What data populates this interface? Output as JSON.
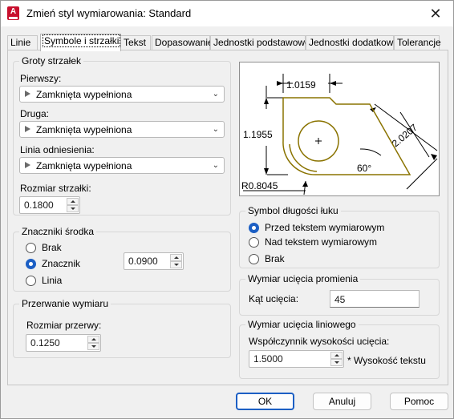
{
  "window": {
    "title": "Zmień styl wymiarowania: Standard",
    "close_glyph": "✕"
  },
  "tabs": [
    {
      "label": "Linie"
    },
    {
      "label": "Symbole i strzałki"
    },
    {
      "label": "Tekst"
    },
    {
      "label": "Dopasowanie"
    },
    {
      "label": "Jednostki podstawowe"
    },
    {
      "label": "Jednostki dodatkowe"
    },
    {
      "label": "Tolerancje"
    }
  ],
  "arrowheads": {
    "group_label": "Groty strzałek",
    "first_label": "Pierwszy:",
    "first_value": "Zamknięta wypełniona",
    "second_label": "Druga:",
    "second_value": "Zamknięta wypełniona",
    "leader_label": "Linia odniesienia:",
    "leader_value": "Zamknięta wypełniona",
    "size_label": "Rozmiar strzałki:",
    "size_value": "0.1800"
  },
  "center_marks": {
    "group_label": "Znaczniki środka",
    "options": [
      "Brak",
      "Znacznik",
      "Linia"
    ],
    "selected": "Znacznik",
    "size_value": "0.0900"
  },
  "dim_break": {
    "group_label": "Przerwanie wymiaru",
    "size_label": "Rozmiar przerwy:",
    "size_value": "0.1250"
  },
  "preview": {
    "dim_top": "1.0159",
    "dim_left": "1.1955",
    "dim_right": "2.0207",
    "dim_angle": "60°",
    "dim_radius": "R0.8045",
    "line_color": "#8a7300"
  },
  "arc_length": {
    "group_label": "Symbol długości łuku",
    "options": [
      "Przed tekstem wymiarowym",
      "Nad tekstem wymiarowym",
      "Brak"
    ],
    "selected": "Przed tekstem wymiarowym"
  },
  "radius_jog": {
    "group_label": "Wymiar ucięcia promienia",
    "angle_label": "Kąt ucięcia:",
    "angle_value": "45"
  },
  "linear_jog": {
    "group_label": "Wymiar ucięcia liniowego",
    "factor_label": "Współczynnik wysokości ucięcia:",
    "factor_value": "1.5000",
    "suffix": "* Wysokość tekstu"
  },
  "buttons": {
    "ok": "OK",
    "cancel": "Anuluj",
    "help": "Pomoc"
  },
  "colors": {
    "accent": "#1c5fc4",
    "app_icon": "#c8102e"
  }
}
